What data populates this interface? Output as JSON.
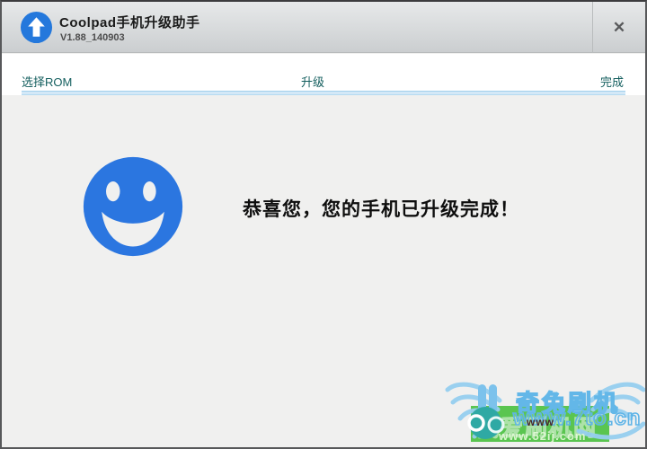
{
  "titlebar": {
    "title": "Coolpad手机升级助手",
    "version": "V1.88_140903",
    "close_glyph": "✕"
  },
  "nav": {
    "steps": [
      {
        "label": "选择ROM"
      },
      {
        "label": "升级"
      },
      {
        "label": "完成"
      }
    ],
    "progress_percent": 100
  },
  "main": {
    "message": "恭喜您，您的手机已升级完成！"
  },
  "watermark": {
    "brand": "奇兔刷机",
    "site_url": "www.7to.cn",
    "overlay_www": "www",
    "secondary_site_url": "www.52ij.com",
    "faint_text": "我爱刷机网"
  },
  "colors": {
    "accent_blue": "#2b76e0",
    "step_teal": "#135e5e",
    "progress_blue": "#d3e8f7",
    "watermark_blue": "#63b7e8",
    "watermark_green": "#44be3a"
  }
}
